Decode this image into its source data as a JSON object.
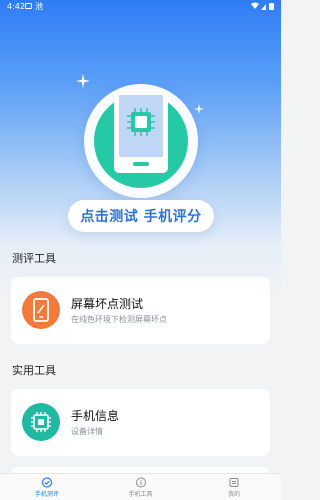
{
  "status_bar": {
    "time": "4:42",
    "notification_char": "池"
  },
  "hero": {
    "cta_label": "点击测试 手机评分"
  },
  "sections": [
    {
      "title": "测评工具",
      "cards": [
        {
          "title": "屏幕坏点测试",
          "subtitle": "在纯色环境下检测屏幕坏点",
          "icon": "phone-screen-icon",
          "icon_color": "#f07b3c"
        }
      ]
    },
    {
      "title": "实用工具",
      "cards": [
        {
          "title": "手机信息",
          "subtitle": "设备详情",
          "icon": "chip-icon",
          "icon_color": "#21b8a4"
        }
      ]
    }
  ],
  "tabbar": {
    "items": [
      {
        "label": "手机测评",
        "icon": "check-circle-icon",
        "active": true
      },
      {
        "label": "手机工具",
        "icon": "info-circle-icon",
        "active": false
      },
      {
        "label": "我的",
        "icon": "profile-card-icon",
        "active": false
      }
    ]
  },
  "colors": {
    "primary": "#2f7df6",
    "accent_green": "#26c9a5",
    "accent_orange": "#f07b3c"
  }
}
